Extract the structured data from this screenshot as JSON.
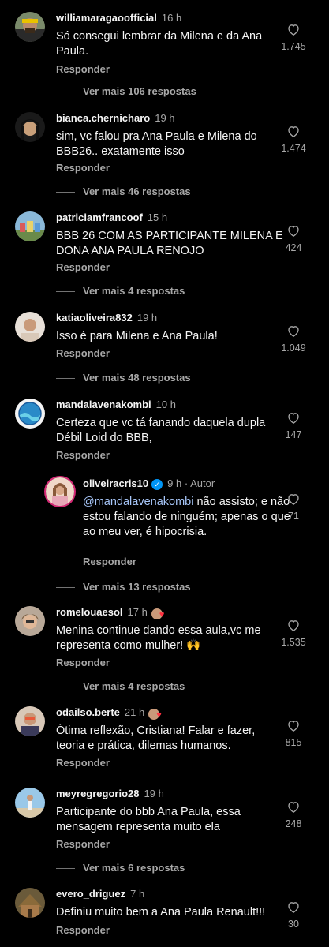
{
  "comments": [
    {
      "username": "williamaragaoofficial",
      "time": "16 h",
      "text": "Só consegui lembrar da Milena e da Ana Paula.",
      "likes": "1.745",
      "reply_label": "Responder",
      "more_replies": "Ver mais 106 respostas"
    },
    {
      "username": "bianca.chernicharo",
      "time": "19 h",
      "text": "sim, vc falou pra Ana Paula e Milena do BBB26.. exatamente isso",
      "likes": "1.474",
      "reply_label": "Responder",
      "more_replies": "Ver mais 46 respostas"
    },
    {
      "username": "patriciamfrancoof",
      "time": "15 h",
      "text": "BBB 26 COM AS PARTICIPANTE MILENA E DONA ANA PAULA RENOJO",
      "likes": "424",
      "reply_label": "Responder",
      "more_replies": "Ver mais 4 respostas"
    },
    {
      "username": "katiaoliveira832",
      "time": "19 h",
      "text": "Isso é para Milena e Ana Paula!",
      "likes": "1.049",
      "reply_label": "Responder",
      "more_replies": "Ver mais 48 respostas"
    },
    {
      "username": "mandalavenakombi",
      "time": "10 h",
      "text": "Certeza que vc tá fanando daquela dupla Débil Loid do BBB,",
      "likes": "147",
      "reply_label": "Responder"
    },
    {
      "username": "romelouaesol",
      "time": "17 h",
      "text": "Menina continue dando essa aula,vc me representa como mulher! 🙌",
      "likes": "1.535",
      "reply_label": "Responder",
      "more_replies": "Ver mais 4 respostas"
    },
    {
      "username": "odailso.berte",
      "time": "21 h",
      "text": "Ótima reflexão, Cristiana! Falar e fazer, teoria e prática, dilemas humanos.",
      "likes": "815",
      "reply_label": "Responder"
    },
    {
      "username": "meyregregorio28",
      "time": "19 h",
      "text": "Participante do bbb Ana Paula, essa mensagem representa muito ela",
      "likes": "248",
      "reply_label": "Responder",
      "more_replies": "Ver mais 6 respostas"
    },
    {
      "username": "evero_driguez",
      "time": "7 h",
      "text": "Definiu muito bem a Ana Paula Renault!!!",
      "likes": "30",
      "reply_label": "Responder"
    }
  ],
  "reply": {
    "username": "oliveiracris10",
    "time": "9 h",
    "author_badge": "Autor",
    "separator": "·",
    "mention": "@mandalavenakombi",
    "text": " não assisto; e não estou falando de ninguém; apenas o que ao meu ver, é hipocrisia.",
    "likes": "71",
    "reply_label": "Responder",
    "more_replies": "Ver mais 13 respostas"
  },
  "colors": {
    "background": "#000000",
    "text": "#f5f5f5",
    "secondary": "#a8a8a8",
    "mention": "#a8c7fa",
    "verified": "#0095f6",
    "heart": "#ff3040"
  },
  "icons": {
    "like": "heart-outline-icon",
    "verified": "verified-badge-icon"
  }
}
